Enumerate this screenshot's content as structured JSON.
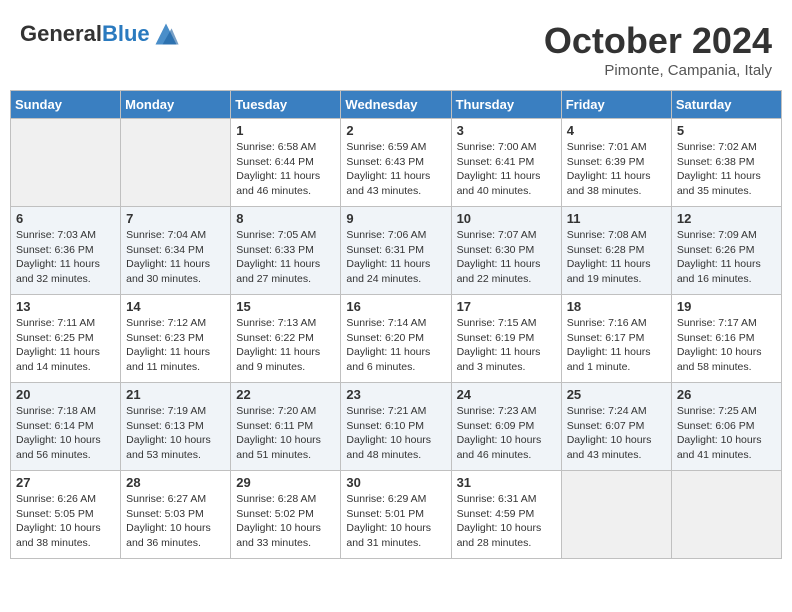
{
  "header": {
    "logo_general": "General",
    "logo_blue": "Blue",
    "month_title": "October 2024",
    "location": "Pimonte, Campania, Italy"
  },
  "days_of_week": [
    "Sunday",
    "Monday",
    "Tuesday",
    "Wednesday",
    "Thursday",
    "Friday",
    "Saturday"
  ],
  "weeks": [
    [
      {
        "day": null,
        "info": null
      },
      {
        "day": null,
        "info": null
      },
      {
        "day": "1",
        "info": "Sunrise: 6:58 AM\nSunset: 6:44 PM\nDaylight: 11 hours and 46 minutes."
      },
      {
        "day": "2",
        "info": "Sunrise: 6:59 AM\nSunset: 6:43 PM\nDaylight: 11 hours and 43 minutes."
      },
      {
        "day": "3",
        "info": "Sunrise: 7:00 AM\nSunset: 6:41 PM\nDaylight: 11 hours and 40 minutes."
      },
      {
        "day": "4",
        "info": "Sunrise: 7:01 AM\nSunset: 6:39 PM\nDaylight: 11 hours and 38 minutes."
      },
      {
        "day": "5",
        "info": "Sunrise: 7:02 AM\nSunset: 6:38 PM\nDaylight: 11 hours and 35 minutes."
      }
    ],
    [
      {
        "day": "6",
        "info": "Sunrise: 7:03 AM\nSunset: 6:36 PM\nDaylight: 11 hours and 32 minutes."
      },
      {
        "day": "7",
        "info": "Sunrise: 7:04 AM\nSunset: 6:34 PM\nDaylight: 11 hours and 30 minutes."
      },
      {
        "day": "8",
        "info": "Sunrise: 7:05 AM\nSunset: 6:33 PM\nDaylight: 11 hours and 27 minutes."
      },
      {
        "day": "9",
        "info": "Sunrise: 7:06 AM\nSunset: 6:31 PM\nDaylight: 11 hours and 24 minutes."
      },
      {
        "day": "10",
        "info": "Sunrise: 7:07 AM\nSunset: 6:30 PM\nDaylight: 11 hours and 22 minutes."
      },
      {
        "day": "11",
        "info": "Sunrise: 7:08 AM\nSunset: 6:28 PM\nDaylight: 11 hours and 19 minutes."
      },
      {
        "day": "12",
        "info": "Sunrise: 7:09 AM\nSunset: 6:26 PM\nDaylight: 11 hours and 16 minutes."
      }
    ],
    [
      {
        "day": "13",
        "info": "Sunrise: 7:11 AM\nSunset: 6:25 PM\nDaylight: 11 hours and 14 minutes."
      },
      {
        "day": "14",
        "info": "Sunrise: 7:12 AM\nSunset: 6:23 PM\nDaylight: 11 hours and 11 minutes."
      },
      {
        "day": "15",
        "info": "Sunrise: 7:13 AM\nSunset: 6:22 PM\nDaylight: 11 hours and 9 minutes."
      },
      {
        "day": "16",
        "info": "Sunrise: 7:14 AM\nSunset: 6:20 PM\nDaylight: 11 hours and 6 minutes."
      },
      {
        "day": "17",
        "info": "Sunrise: 7:15 AM\nSunset: 6:19 PM\nDaylight: 11 hours and 3 minutes."
      },
      {
        "day": "18",
        "info": "Sunrise: 7:16 AM\nSunset: 6:17 PM\nDaylight: 11 hours and 1 minute."
      },
      {
        "day": "19",
        "info": "Sunrise: 7:17 AM\nSunset: 6:16 PM\nDaylight: 10 hours and 58 minutes."
      }
    ],
    [
      {
        "day": "20",
        "info": "Sunrise: 7:18 AM\nSunset: 6:14 PM\nDaylight: 10 hours and 56 minutes."
      },
      {
        "day": "21",
        "info": "Sunrise: 7:19 AM\nSunset: 6:13 PM\nDaylight: 10 hours and 53 minutes."
      },
      {
        "day": "22",
        "info": "Sunrise: 7:20 AM\nSunset: 6:11 PM\nDaylight: 10 hours and 51 minutes."
      },
      {
        "day": "23",
        "info": "Sunrise: 7:21 AM\nSunset: 6:10 PM\nDaylight: 10 hours and 48 minutes."
      },
      {
        "day": "24",
        "info": "Sunrise: 7:23 AM\nSunset: 6:09 PM\nDaylight: 10 hours and 46 minutes."
      },
      {
        "day": "25",
        "info": "Sunrise: 7:24 AM\nSunset: 6:07 PM\nDaylight: 10 hours and 43 minutes."
      },
      {
        "day": "26",
        "info": "Sunrise: 7:25 AM\nSunset: 6:06 PM\nDaylight: 10 hours and 41 minutes."
      }
    ],
    [
      {
        "day": "27",
        "info": "Sunrise: 6:26 AM\nSunset: 5:05 PM\nDaylight: 10 hours and 38 minutes."
      },
      {
        "day": "28",
        "info": "Sunrise: 6:27 AM\nSunset: 5:03 PM\nDaylight: 10 hours and 36 minutes."
      },
      {
        "day": "29",
        "info": "Sunrise: 6:28 AM\nSunset: 5:02 PM\nDaylight: 10 hours and 33 minutes."
      },
      {
        "day": "30",
        "info": "Sunrise: 6:29 AM\nSunset: 5:01 PM\nDaylight: 10 hours and 31 minutes."
      },
      {
        "day": "31",
        "info": "Sunrise: 6:31 AM\nSunset: 4:59 PM\nDaylight: 10 hours and 28 minutes."
      },
      {
        "day": null,
        "info": null
      },
      {
        "day": null,
        "info": null
      }
    ]
  ]
}
